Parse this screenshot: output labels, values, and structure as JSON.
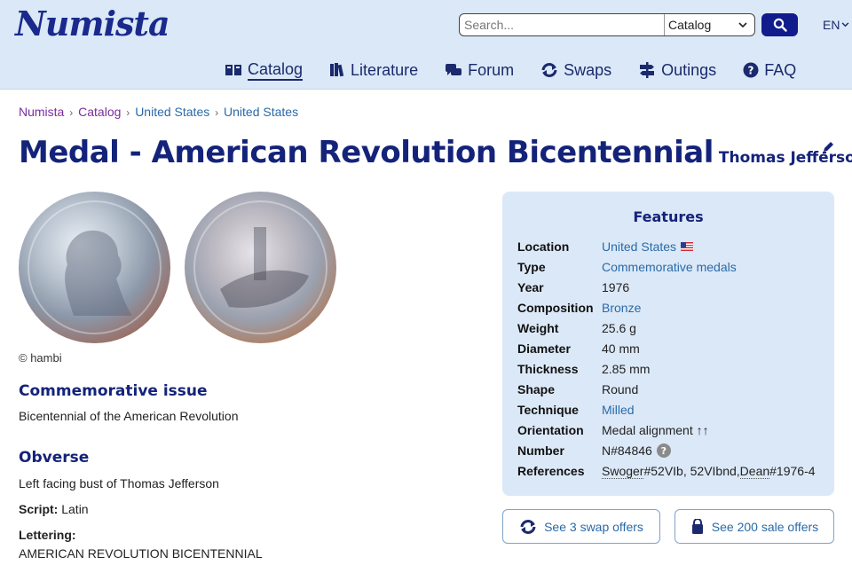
{
  "header": {
    "logo": "Numista",
    "search": {
      "placeholder": "Search...",
      "category": "Catalog"
    },
    "language": "EN",
    "nav": [
      {
        "label": "Catalog",
        "icon": "catalog-book-icon",
        "active": true
      },
      {
        "label": "Literature",
        "icon": "books-icon"
      },
      {
        "label": "Forum",
        "icon": "chat-bubbles-icon"
      },
      {
        "label": "Swaps",
        "icon": "swap-arrows-icon"
      },
      {
        "label": "Outings",
        "icon": "signpost-icon"
      },
      {
        "label": "FAQ",
        "icon": "question-icon"
      }
    ]
  },
  "breadcrumb": [
    "Numista",
    "Catalog",
    "United States",
    "United States"
  ],
  "page": {
    "title": "Medal - American Revolution Bicentennial",
    "subtitle": "Thomas Jefferson"
  },
  "images": {
    "copyright": "© hambi"
  },
  "commemorative": {
    "heading": "Commemorative issue",
    "text": "Bicentennial of the American Revolution"
  },
  "obverse": {
    "heading": "Obverse",
    "description": "Left facing bust of Thomas Jefferson",
    "script_label": "Script:",
    "script_value": "Latin",
    "lettering_label": "Lettering:",
    "lettering_value": "AMERICAN REVOLUTION BICENTENNIAL"
  },
  "features": {
    "title": "Features",
    "rows": [
      {
        "key": "Location",
        "value": "United States",
        "link": true,
        "flag": true
      },
      {
        "key": "Type",
        "value": "Commemorative medals",
        "link": true
      },
      {
        "key": "Year",
        "value": "1976"
      },
      {
        "key": "Composition",
        "value": "Bronze",
        "link": true
      },
      {
        "key": "Weight",
        "value": "25.6 g"
      },
      {
        "key": "Diameter",
        "value": "40 mm"
      },
      {
        "key": "Thickness",
        "value": "2.85 mm"
      },
      {
        "key": "Shape",
        "value": "Round"
      },
      {
        "key": "Technique",
        "value": "Milled",
        "link": true
      },
      {
        "key": "Orientation",
        "value": "Medal alignment ↑↑"
      },
      {
        "key": "Number",
        "value": "N#84846",
        "help": "?"
      },
      {
        "key": "References",
        "ref1": "Swoger",
        "ref1_num": "#52VIb, 52VIbnd, ",
        "ref2": "Dean",
        "ref2_num": "#1976-4"
      }
    ]
  },
  "offers": {
    "swap_label": "See 3 swap offers",
    "sale_label": "See 200 sale offers"
  }
}
